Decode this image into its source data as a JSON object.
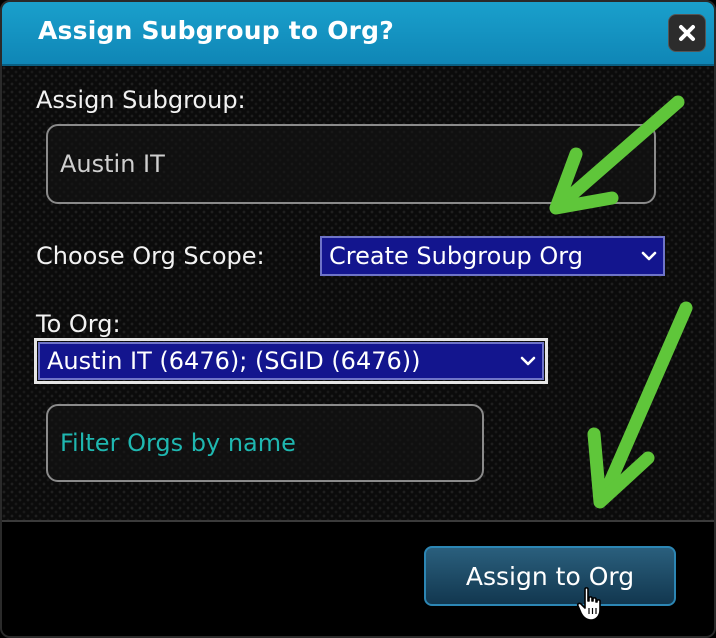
{
  "dialog": {
    "title": "Assign Subgroup to Org?",
    "close_icon": "close-icon"
  },
  "form": {
    "assign_subgroup_label": "Assign Subgroup:",
    "assign_subgroup_value": "Austin IT",
    "org_scope_label": "Choose Org Scope:",
    "org_scope_selected": "Create Subgroup Org",
    "to_org_label": "To Org:",
    "to_org_selected": "Austin IT (6476); (SGID (6476))",
    "filter_placeholder": "Filter Orgs by name"
  },
  "footer": {
    "assign_button_label": "Assign to Org"
  },
  "annotations": {
    "arrow_color": "#5fc63a",
    "arrow_icon": "green-arrow-icon",
    "cursor_icon": "hand-pointer-icon"
  },
  "colors": {
    "titlebar": "#1396c2",
    "select_bg": "#13158e",
    "filter_placeholder": "#1fb7b0"
  }
}
